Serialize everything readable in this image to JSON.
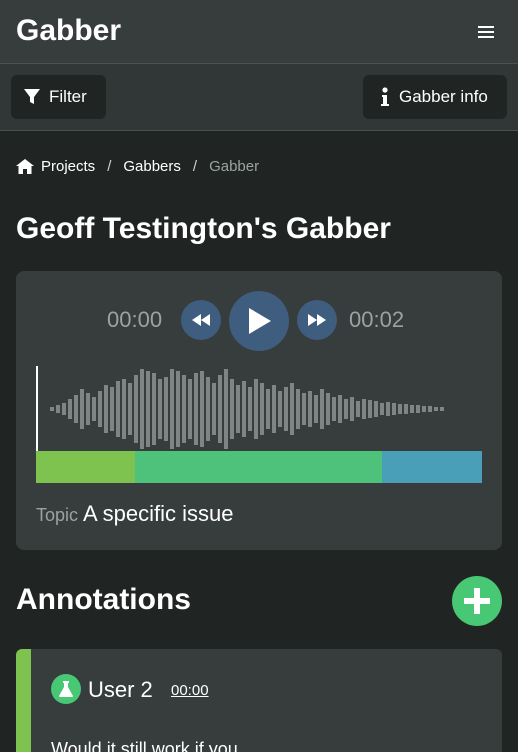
{
  "app": {
    "brand": "Gabber"
  },
  "toolbar": {
    "filter_label": "Filter",
    "info_label": "Gabber info"
  },
  "breadcrumb": {
    "items": [
      "Projects",
      "Gabbers",
      "Gabber"
    ]
  },
  "page": {
    "title": "Geoff Testington's Gabber"
  },
  "player": {
    "time_start": "00:00",
    "time_end": "00:02",
    "topic_label": "Topic",
    "topic_value": "A specific issue",
    "timeline_colors": [
      "#7ec250",
      "#4ec27a",
      "#4a9fb8"
    ]
  },
  "annotations": {
    "title": "Annotations",
    "items": [
      {
        "user": "User 2",
        "time": "00:00",
        "text": "Would it still work if you"
      }
    ]
  },
  "colors": {
    "accent": "#48c774",
    "player_button": "#3f5d7e",
    "card": "#373c3d"
  },
  "icons": [
    "menu-icon",
    "filter-icon",
    "info-icon",
    "home-icon",
    "rewind-icon",
    "play-icon",
    "forward-icon",
    "plus-icon",
    "flask-icon"
  ]
}
